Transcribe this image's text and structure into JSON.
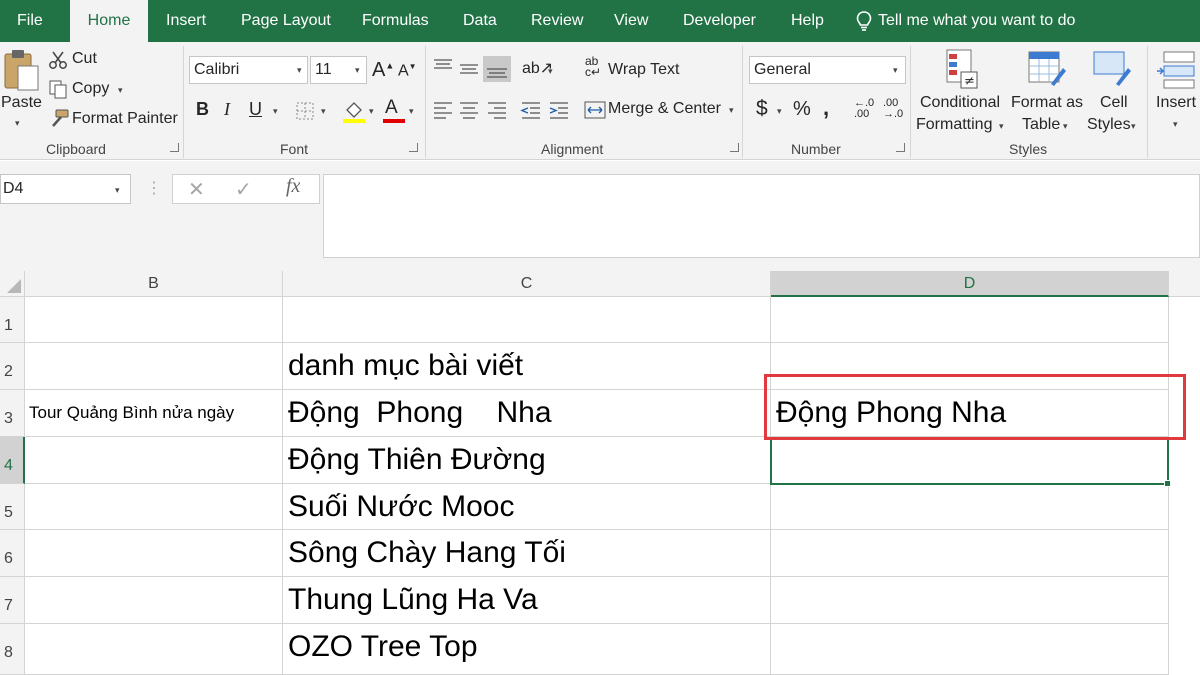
{
  "tabs": [
    {
      "label": "File"
    },
    {
      "label": "Home"
    },
    {
      "label": "Insert"
    },
    {
      "label": "Page Layout"
    },
    {
      "label": "Formulas"
    },
    {
      "label": "Data"
    },
    {
      "label": "Review"
    },
    {
      "label": "View"
    },
    {
      "label": "Developer"
    },
    {
      "label": "Help"
    }
  ],
  "active_tab": "Home",
  "tell_me": "Tell me what you want to do",
  "clipboard": {
    "paste": "Paste",
    "cut": "Cut",
    "copy": "Copy",
    "format_painter": "Format Painter",
    "label": "Clipboard"
  },
  "font": {
    "name": "Calibri",
    "size": "11",
    "label": "Font",
    "bold": "B",
    "italic": "I",
    "underline": "U"
  },
  "alignment": {
    "wrap_text": "Wrap Text",
    "merge_center": "Merge & Center",
    "label": "Alignment"
  },
  "number": {
    "format": "General",
    "currency": "$",
    "percent": "%",
    "comma": "&#44;",
    "label": "Number"
  },
  "styles": {
    "conditional_1": "Conditional",
    "conditional_2": "Formatting",
    "format_table_1": "Format as",
    "format_table_2": "Table",
    "cell_styles_1": "Cell",
    "cell_styles_2": "Styles",
    "label": "Styles"
  },
  "cells_group": {
    "insert": "Insert"
  },
  "formula_bar": {
    "name_box": "D4",
    "formula": "",
    "fx": "fx"
  },
  "grid": {
    "columns": [
      "B",
      "C",
      "D"
    ],
    "selected_column": "D",
    "rows": [
      {
        "num": "1",
        "B": "",
        "C": "",
        "D": ""
      },
      {
        "num": "2",
        "B": "",
        "C": "danh mục bài viết",
        "D": ""
      },
      {
        "num": "3",
        "B": "Tour Quảng Bình nửa ngày",
        "C": "Động  Phong    Nha",
        "D": "Động Phong Nha"
      },
      {
        "num": "4",
        "B": "",
        "C": "Động Thiên Đường",
        "D": ""
      },
      {
        "num": "5",
        "B": "",
        "C": "Suối Nước Mooc",
        "D": ""
      },
      {
        "num": "6",
        "B": "",
        "C": "Sông Chày Hang Tối",
        "D": ""
      },
      {
        "num": "7",
        "B": "",
        "C": "Thung Lũng Ha Va",
        "D": ""
      },
      {
        "num": "8",
        "B": "",
        "C": "OZO Tree Top",
        "D": ""
      }
    ],
    "selected_row": "4",
    "active_cell": "D4"
  },
  "colors": {
    "accent": "#217346",
    "highlight": "#e03a3e"
  }
}
